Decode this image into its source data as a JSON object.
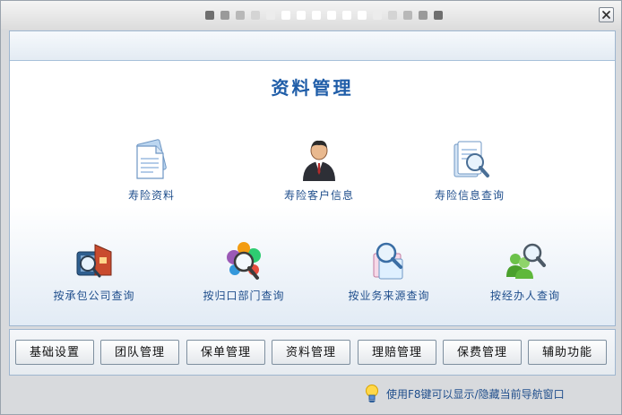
{
  "window": {
    "close_icon": "close-icon"
  },
  "title_dots": [
    "#6f6f6f",
    "#9a9a9a",
    "#b8b8b8",
    "#d4d4d4",
    "#ececec",
    "#ffffff",
    "#ffffff",
    "#ffffff",
    "#ffffff",
    "#ffffff",
    "#ffffff",
    "#ececec",
    "#d4d4d4",
    "#b8b8b8",
    "#9a9a9a",
    "#6f6f6f"
  ],
  "main": {
    "title": "资料管理",
    "items": [
      {
        "label": "寿险资料",
        "icon": "document-icon"
      },
      {
        "label": "寿险客户信息",
        "icon": "person-icon"
      },
      {
        "label": "寿险信息查询",
        "icon": "search-document-icon"
      },
      {
        "label": "按承包公司查询",
        "icon": "company-search-icon"
      },
      {
        "label": "按归口部门查询",
        "icon": "department-search-icon"
      },
      {
        "label": "按业务来源查询",
        "icon": "source-search-icon"
      },
      {
        "label": "按经办人查询",
        "icon": "agent-search-icon"
      }
    ]
  },
  "nav": {
    "buttons": [
      "基础设置",
      "团队管理",
      "保单管理",
      "资料管理",
      "理赔管理",
      "保费管理",
      "辅助功能"
    ]
  },
  "hint": {
    "text": "使用F8键可以显示/隐藏当前导航窗口",
    "icon": "lightbulb-icon"
  },
  "colors": {
    "accent": "#1f5da8",
    "label": "#1f4e8c"
  }
}
